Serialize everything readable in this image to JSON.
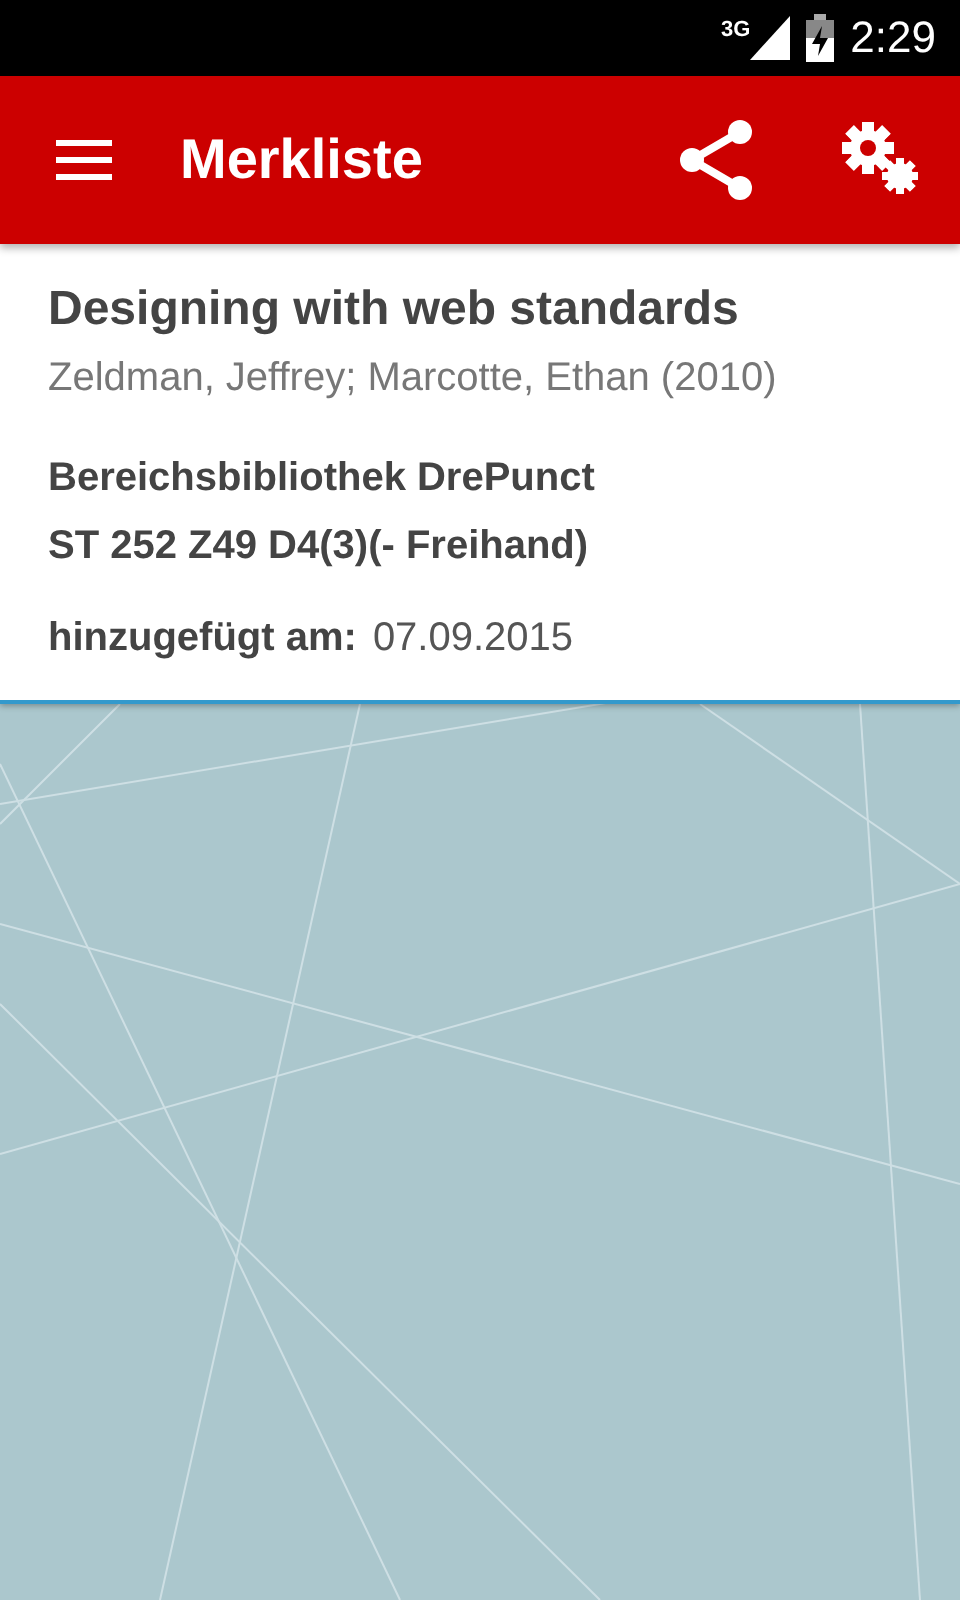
{
  "status_bar": {
    "network": "3G",
    "time": "2:29"
  },
  "toolbar": {
    "title": "Merkliste"
  },
  "items": [
    {
      "title": "Designing with web standards",
      "authors": "Zeldman, Jeffrey; Marcotte, Ethan (2010)",
      "library": "Bereichsbibliothek DrePunct",
      "shelfmark": "ST 252 Z49 D4(3)(- Freihand)",
      "added_label": "hinzugefügt am:",
      "added_date": "07.09.2015"
    }
  ]
}
